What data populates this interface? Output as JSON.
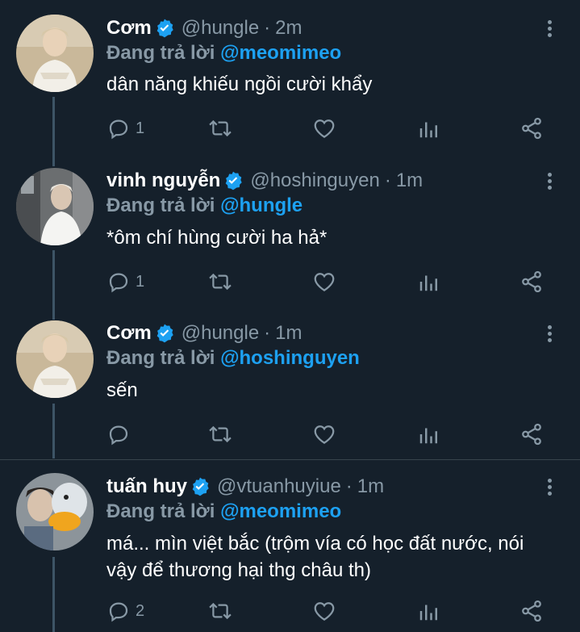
{
  "colors": {
    "background": "#15202b",
    "muted": "#8899a6",
    "accent": "#1da1f2",
    "thread_line": "#3d5466"
  },
  "tweets": [
    {
      "name": "Cơm",
      "handle": "@hungle",
      "time": "2m",
      "reply_prefix": "Đang trả lời",
      "reply_to": "@meomimeo",
      "text": "dân năng khiếu ngồi cười khẩy",
      "reply_count": "1",
      "icons": [
        "reply-icon",
        "retweet-icon",
        "like-icon",
        "analytics-icon",
        "share-icon"
      ]
    },
    {
      "name": "vinh nguyễn",
      "handle": "@hoshinguyen",
      "time": "1m",
      "reply_prefix": "Đang trả lời",
      "reply_to": "@hungle",
      "text": "*ôm chí hùng cười ha hả*",
      "reply_count": "1",
      "icons": [
        "reply-icon",
        "retweet-icon",
        "like-icon",
        "analytics-icon",
        "share-icon"
      ]
    },
    {
      "name": "Cơm",
      "handle": "@hungle",
      "time": "1m",
      "reply_prefix": "Đang trả lời",
      "reply_to": "@hoshinguyen",
      "text": "sến",
      "reply_count": "",
      "icons": [
        "reply-icon",
        "retweet-icon",
        "like-icon",
        "analytics-icon",
        "share-icon"
      ]
    },
    {
      "name": "tuấn huy",
      "handle": "@vtuanhuyiue",
      "time": "1m",
      "reply_prefix": "Đang trả lời",
      "reply_to": "@meomimeo",
      "text": "má... mìn việt bắc (trộm vía có học đất nước, nói vậy để thương hại thg châu th)",
      "reply_count": "2",
      "icons": [
        "reply-icon",
        "retweet-icon",
        "like-icon",
        "analytics-icon",
        "share-icon"
      ]
    }
  ]
}
